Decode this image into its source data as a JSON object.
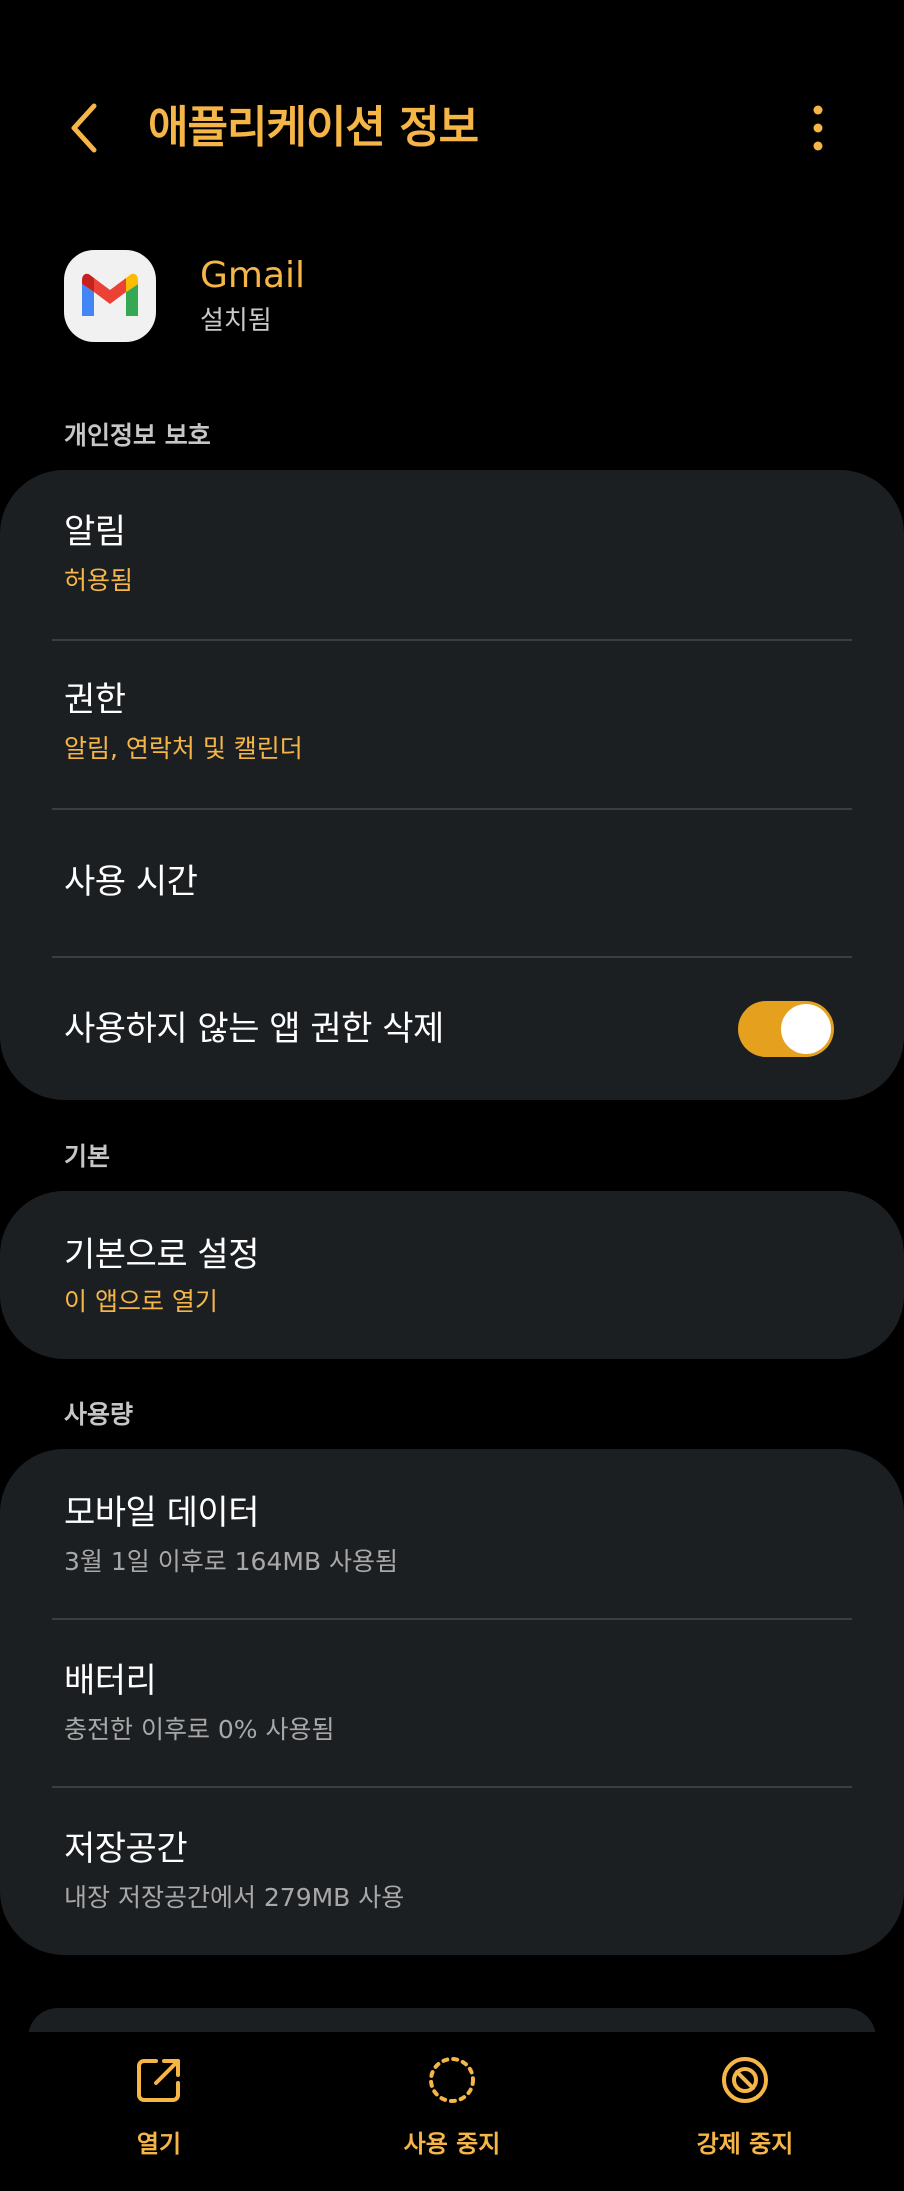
{
  "header": {
    "title": "애플리케이션 정보"
  },
  "app": {
    "name": "Gmail",
    "status": "설치됨"
  },
  "sections": {
    "privacy": {
      "label": "개인정보 보호",
      "items": [
        {
          "title": "알림",
          "subtitle": "허용됨"
        },
        {
          "title": "권한",
          "subtitle": "알림, 연락처 및 캘린더"
        },
        {
          "title": "사용 시간"
        },
        {
          "title": "사용하지 않는 앱 권한 삭제",
          "toggle_on": true
        }
      ]
    },
    "default": {
      "label": "기본",
      "items": [
        {
          "title": "기본으로 설정",
          "subtitle": "이 앱으로 열기"
        }
      ]
    },
    "usage": {
      "label": "사용량",
      "items": [
        {
          "title": "모바일 데이터",
          "subtitle": "3월 1일 이후로 164MB 사용됨"
        },
        {
          "title": "배터리",
          "subtitle": "충전한 이후로 0% 사용됨"
        },
        {
          "title": "저장공간",
          "subtitle": "내장 저장공간에서 279MB 사용"
        }
      ]
    }
  },
  "bottom_bar": {
    "open_label": "열기",
    "disable_label": "사용 중지",
    "force_stop_label": "강제 중지"
  },
  "icons": {
    "back": "chevron-left-icon",
    "more": "more-vertical-icon",
    "app": "gmail-logo",
    "open": "open-external-icon",
    "disable": "dotted-circle-icon",
    "force_stop": "stop-circle-icon"
  },
  "colors": {
    "accent": "#f5b547",
    "toggle": "#e5a11e",
    "card": "#1c1f22",
    "background": "#000000"
  }
}
